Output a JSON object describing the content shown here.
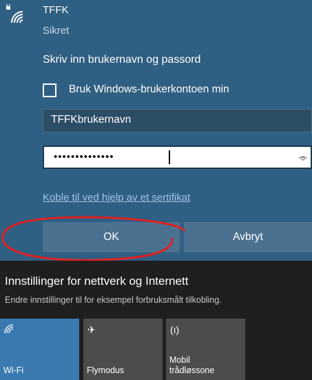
{
  "network": {
    "name": "TFFK",
    "status": "Sikret"
  },
  "login": {
    "prompt": "Skriv inn brukernavn og passord",
    "checkbox_label": "Bruk Windows-brukerkontoen min",
    "checkbox_checked": false,
    "username_value": "TFFKbrukernavn",
    "password_mask": "••••••••••••••",
    "certificate_link": "Koble til ved hjelp av et sertifikat",
    "ok_label": "OK",
    "cancel_label": "Avbryt"
  },
  "settings": {
    "title": "Innstillinger for nettverk og Internett",
    "subtitle": "Endre innstillinger til for eksempel forbruksmålt tilkobling."
  },
  "quick_actions": [
    {
      "label": "Wi-Fi",
      "icon": "wifi-icon",
      "active": true
    },
    {
      "label": "Flymodus",
      "icon": "airplane-icon",
      "active": false
    },
    {
      "label": "Mobil trådløssone",
      "label_line1": "Mobil",
      "label_line2": "trådløssone",
      "icon": "hotspot-icon",
      "active": false
    }
  ],
  "colors": {
    "panel": "#2f5f82",
    "button": "#4b7190",
    "link": "#9fc6e6",
    "taskbar": "#1f1f1f",
    "tile_active": "#3a7ab1",
    "tile_inactive": "#4c4c4c",
    "annotation": "#e02020"
  }
}
